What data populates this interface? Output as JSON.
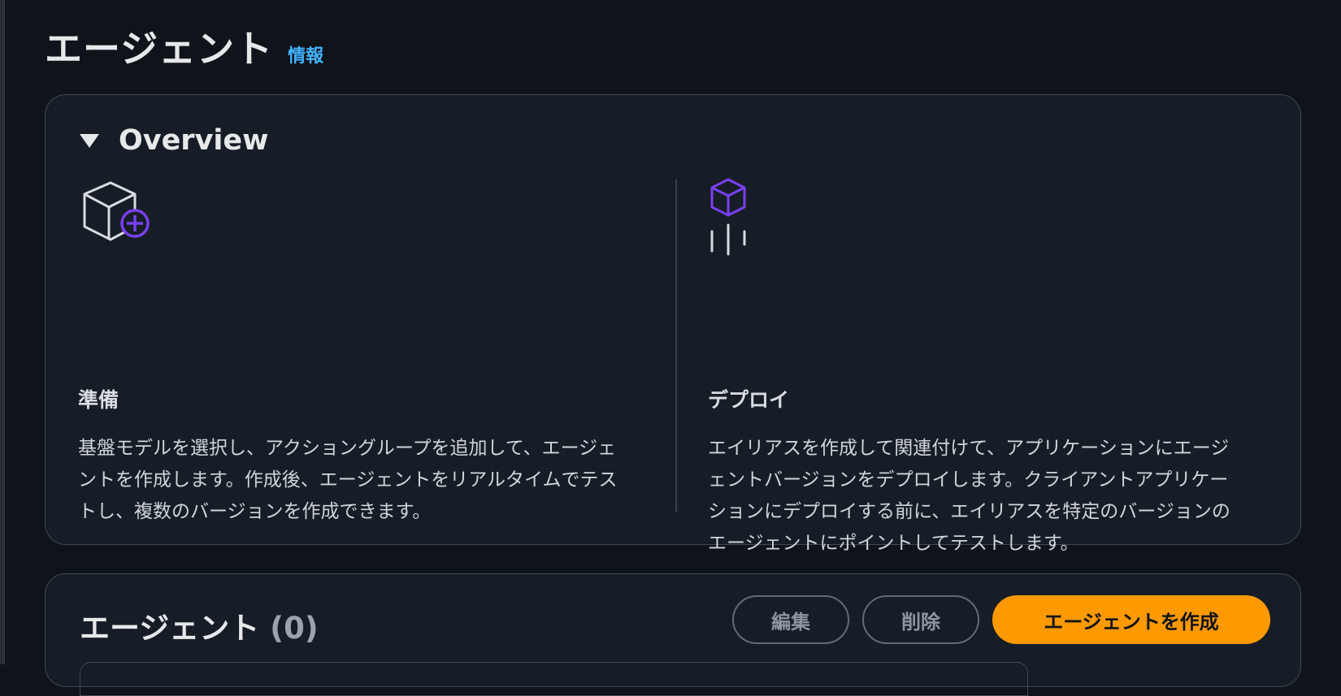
{
  "header": {
    "title": "エージェント",
    "info_link": "情報"
  },
  "overview": {
    "title": "Overview",
    "steps": [
      {
        "icon": "cube-plus-icon",
        "heading": "準備",
        "description": "基盤モデルを選択し、アクショングループを追加して、エージェントを作成します。作成後、エージェントをリアルタイムでテストし、複数のバージョンを作成できます。"
      },
      {
        "icon": "cube-deploy-icon",
        "heading": "デプロイ",
        "description": "エイリアスを作成して関連付けて、アプリケーションにエージェントバージョンをデプロイします。クライアントアプリケーションにデプロイする前に、エイリアスを特定のバージョンのエージェントにポイントしてテストします。"
      }
    ]
  },
  "agents": {
    "title": "エージェント",
    "count": "(0)",
    "edit_label": "編集",
    "delete_label": "削除",
    "create_label": "エージェントを作成"
  },
  "colors": {
    "background": "#0f141a",
    "panel": "#161d26",
    "accent_orange": "#ff9900",
    "link_blue": "#42b4ff",
    "icon_purple": "#7b3ff2"
  }
}
